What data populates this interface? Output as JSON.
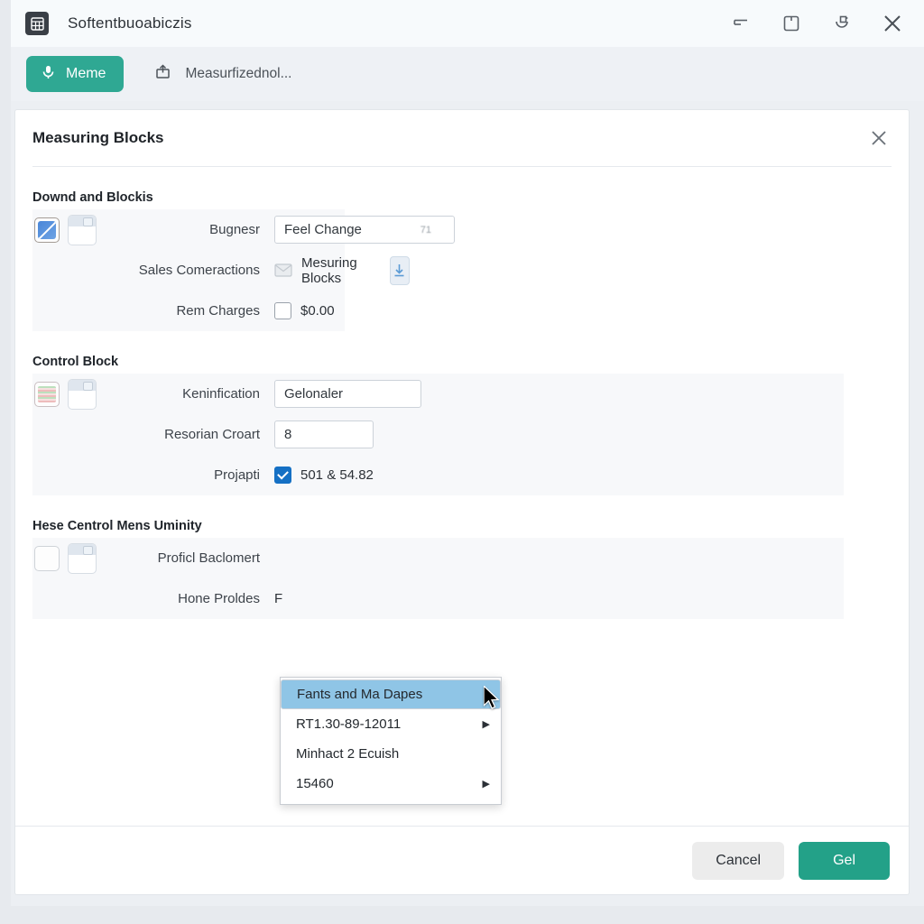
{
  "window": {
    "title": "Softentbuoabiczis",
    "app_icon": "grid-icon",
    "controls": [
      {
        "name": "align-left-icon",
        "label": "Minimize"
      },
      {
        "name": "save-box-icon",
        "label": "Maximize"
      },
      {
        "name": "restore-icon",
        "label": "Restore"
      },
      {
        "name": "close-icon",
        "label": "Close"
      }
    ]
  },
  "toolbar": {
    "primary_button": {
      "label": "Meme",
      "icon": "microphone-icon",
      "color": "#2fa893"
    },
    "tab": {
      "label": "Measurfizednol...",
      "icon": "upload-icon"
    }
  },
  "dialog": {
    "title": "Measuring Blocks",
    "close_icon": "close-icon",
    "sections": [
      {
        "title": "Downd and Blockis",
        "gutter": {
          "tile": "edit-tile-icon",
          "doc": "document-icon"
        },
        "rows": [
          {
            "label": "Bugnesr",
            "control": "select",
            "value": "Feel Change",
            "ghost": "71"
          },
          {
            "label": "Sales Comeractions",
            "control": "mail-text",
            "icon": "mail-icon",
            "value": "Mesuring Blocks",
            "action_icon": "download-icon"
          },
          {
            "label": "Rem Charges",
            "control": "checkbox",
            "checked": false,
            "value": "$0.00"
          }
        ]
      },
      {
        "title": "Control Block",
        "gutter": {
          "tile": "spreadsheet-tile-icon",
          "doc": "document-icon"
        },
        "rows": [
          {
            "label": "Keninfication",
            "control": "select",
            "value": "Gelonaler"
          },
          {
            "label": "Resorian Croart",
            "control": "select",
            "value": "8"
          },
          {
            "label": "Projapti",
            "control": "checkbox",
            "checked": true,
            "value": "501 & 54.82"
          }
        ]
      },
      {
        "title": "Hese Centrol Mens Uminity",
        "gutter": {
          "tile": "empty-tile-icon",
          "doc": "document-icon"
        },
        "rows": [
          {
            "label": "Proficl Baclomert",
            "control": "hidden",
            "value": ""
          },
          {
            "label": "Hone Proldes",
            "control": "partial",
            "value": "F"
          }
        ]
      }
    ],
    "context_menu": {
      "items": [
        {
          "label": "Fants and Ma Dapes",
          "selected": true,
          "submenu": false
        },
        {
          "label": "RT1.30-89-12011",
          "selected": false,
          "submenu": true
        },
        {
          "label": "Minhact 2 Ecuish",
          "selected": false,
          "submenu": false
        },
        {
          "label": "15460",
          "selected": false,
          "submenu": true
        }
      ],
      "highlight_color": "#8fc5e6"
    },
    "footer": {
      "cancel_label": "Cancel",
      "confirm_label": "Gel",
      "confirm_color": "#23a188"
    }
  }
}
